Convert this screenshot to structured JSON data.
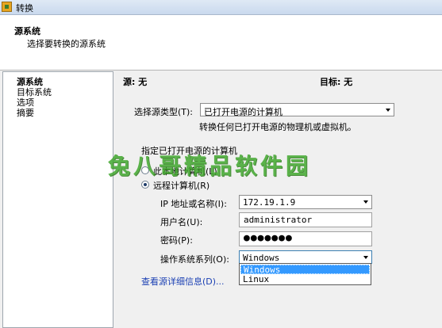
{
  "window": {
    "title": "转换"
  },
  "header": {
    "title": "源系统",
    "subtitle": "选择要转换的源系统"
  },
  "sidebar": {
    "items": [
      {
        "label": "源系统"
      },
      {
        "label": "目标系统"
      },
      {
        "label": "选项"
      },
      {
        "label": "摘要"
      }
    ]
  },
  "main": {
    "source_label": "源: 无",
    "target_label": "目标: 无",
    "source_type_label": "选择源类型(T):",
    "source_type_value": "已打开电源的计算机",
    "source_type_desc": "转换任何已打开电源的物理机或虚拟机。",
    "specify_label": "指定已打开电源的计算机",
    "radio_local": "此本地计算机(L)",
    "radio_remote": "远程计算机(R)",
    "ip_label": "IP 地址或名称(I):",
    "ip_value": "172.19.1.9",
    "username_label": "用户名(U):",
    "username_value": "administrator",
    "password_label": "密码(P):",
    "password_value": "●●●●●●●",
    "os_label": "操作系统系列(O):",
    "os_value": "Windows",
    "os_options": [
      "Windows",
      "Linux"
    ],
    "details_link": "查看源详细信息(D)..."
  },
  "watermark": "兔八哥精品软件园",
  "colors": {
    "accent": "#3399ff",
    "link": "#1a3fb3",
    "watermark": "#41a82e"
  }
}
